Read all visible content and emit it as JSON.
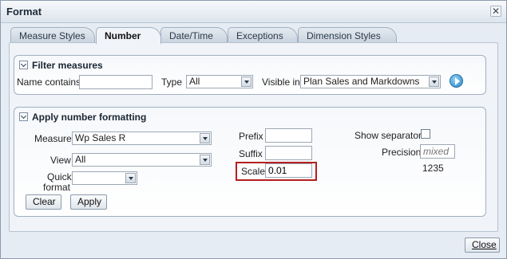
{
  "dialog": {
    "title": "Format",
    "close_glyph": "✕",
    "close_button_label": "Close"
  },
  "tabs": [
    {
      "label": "Measure Styles",
      "active": false
    },
    {
      "label": "Number",
      "active": true
    },
    {
      "label": "Date/Time",
      "active": false
    },
    {
      "label": "Exceptions",
      "active": false
    },
    {
      "label": "Dimension Styles",
      "active": false
    }
  ],
  "filter": {
    "header": "Filter measures",
    "name_contains_label": "Name contains",
    "name_contains_value": "",
    "type_label": "Type",
    "type_value": "All",
    "visible_in_label": "Visible in",
    "visible_in_value": "Plan Sales and Markdowns"
  },
  "formatting": {
    "header": "Apply number formatting",
    "measure_label": "Measure",
    "measure_value": "Wp Sales R",
    "view_label": "View",
    "view_value": "All",
    "quick_format_label_1": "Quick",
    "quick_format_label_2": "format",
    "quick_format_value": "",
    "clear_label": "Clear",
    "apply_label": "Apply",
    "prefix_label": "Prefix",
    "prefix_value": "",
    "suffix_label": "Suffix",
    "suffix_value": "",
    "scale_label": "Scale",
    "scale_value": "0.01",
    "show_separator_label": "Show separator",
    "show_separator_checked": false,
    "precision_label": "Precision",
    "precision_placeholder": "mixed",
    "sample_value": "1235"
  },
  "colors": {
    "highlight": "#b52020",
    "accent": "#2a88c8"
  }
}
